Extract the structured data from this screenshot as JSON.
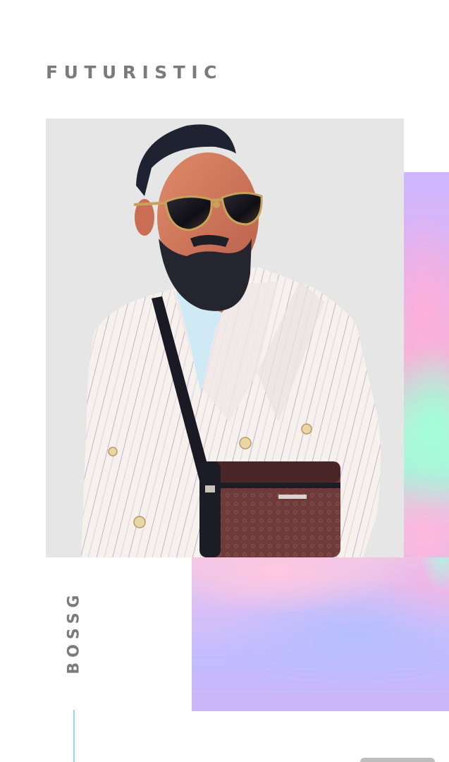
{
  "header": {
    "title": "FUTURISTIC"
  },
  "photo": {
    "alt": "Bearded man in a white pinstripe double-breasted blazer with aviator sunglasses and a crossbody bag"
  },
  "side_label": {
    "text": "BOSSG"
  },
  "colors": {
    "heading_text": "#7b7b7b",
    "photo_background": "#e6e6e6",
    "accent_line": "#9fd3ea",
    "holo_lavender": "#c4b0ff",
    "holo_pink": "#f3b5da",
    "holo_mint": "#a8f3dd"
  }
}
